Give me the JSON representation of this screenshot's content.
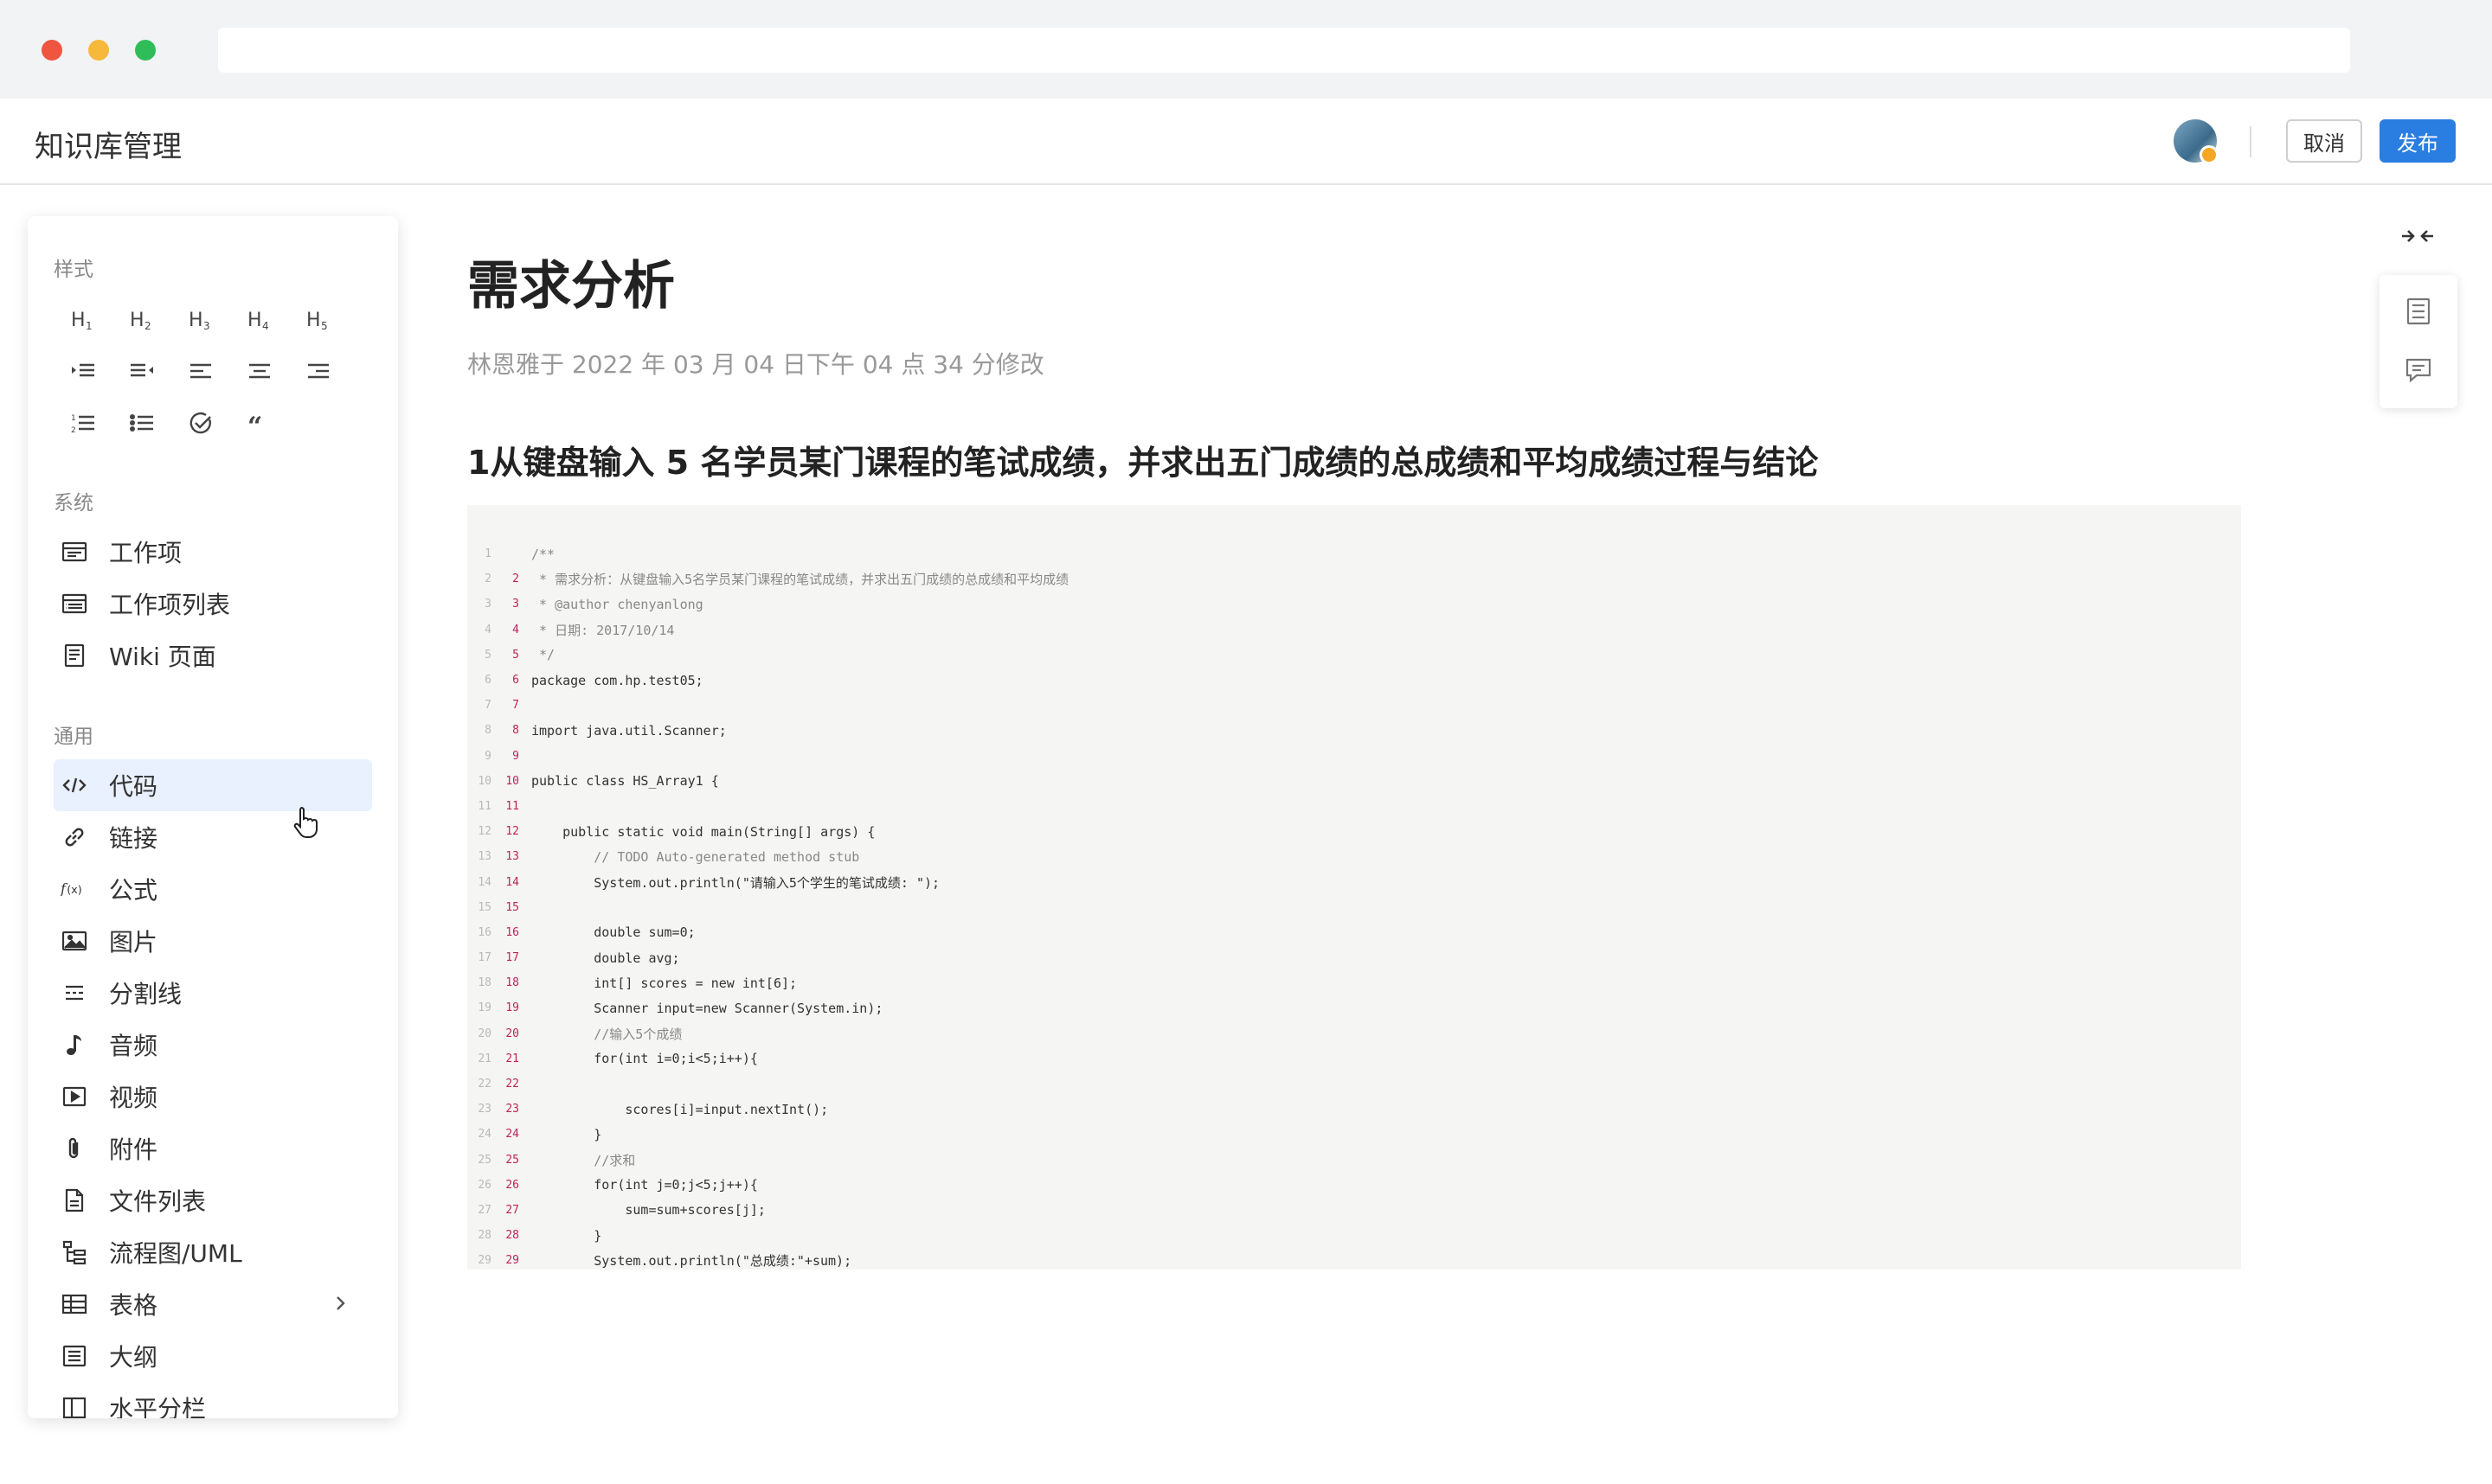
{
  "app": {
    "title": "知识库管理",
    "cancel_label": "取消",
    "publish_label": "发布"
  },
  "panel": {
    "style_label": "样式",
    "headings": [
      "H1",
      "H2",
      "H3",
      "H4",
      "H5"
    ],
    "system_label": "系统",
    "system_items": [
      "工作项",
      "工作项列表",
      "Wiki 页面"
    ],
    "general_label": "通用",
    "general_items": [
      "代码",
      "链接",
      "公式",
      "图片",
      "分割线",
      "音频",
      "视频",
      "附件",
      "文件列表",
      "流程图/UML",
      "表格",
      "大纲",
      "水平分栏"
    ]
  },
  "doc": {
    "title": "需求分析",
    "meta": "林恩雅于 2022 年 03 月 04 日下午 04 点 34 分修改",
    "heading": "1从键盘输入 5 名学员某门课程的笔试成绩，并求出五门成绩的总成绩和平均成绩过程与结论"
  },
  "code": {
    "lines": [
      {
        "n": "1",
        "m": "",
        "t": "/**"
      },
      {
        "n": "2",
        "m": "2",
        "t": " * 需求分析：从键盘输入5名学员某门课程的笔试成绩，并求出五门成绩的总成绩和平均成绩"
      },
      {
        "n": "3",
        "m": "3",
        "t": " * @author chenyanlong"
      },
      {
        "n": "4",
        "m": "4",
        "t": " * 日期: 2017/10/14"
      },
      {
        "n": "5",
        "m": "5",
        "t": " */"
      },
      {
        "n": "6",
        "m": "6",
        "t": "package com.hp.test05;"
      },
      {
        "n": "7",
        "m": "7",
        "t": ""
      },
      {
        "n": "8",
        "m": "8",
        "t": "import java.util.Scanner;"
      },
      {
        "n": "9",
        "m": "9",
        "t": ""
      },
      {
        "n": "10",
        "m": "10",
        "t": "public class HS_Array1 {"
      },
      {
        "n": "11",
        "m": "11",
        "t": ""
      },
      {
        "n": "12",
        "m": "12",
        "t": "    public static void main(String[] args) {"
      },
      {
        "n": "13",
        "m": "13",
        "t": "        // TODO Auto-generated method stub"
      },
      {
        "n": "14",
        "m": "14",
        "t": "        System.out.println(\"请输入5个学生的笔试成绩: \");"
      },
      {
        "n": "15",
        "m": "15",
        "t": ""
      },
      {
        "n": "16",
        "m": "16",
        "t": "        double sum=0;"
      },
      {
        "n": "17",
        "m": "17",
        "t": "        double avg;"
      },
      {
        "n": "18",
        "m": "18",
        "t": "        int[] scores = new int[6];"
      },
      {
        "n": "19",
        "m": "19",
        "t": "        Scanner input=new Scanner(System.in);"
      },
      {
        "n": "20",
        "m": "20",
        "t": "        //输入5个成绩"
      },
      {
        "n": "21",
        "m": "21",
        "t": "        for(int i=0;i<5;i++){"
      },
      {
        "n": "22",
        "m": "22",
        "t": ""
      },
      {
        "n": "23",
        "m": "23",
        "t": "            scores[i]=input.nextInt();"
      },
      {
        "n": "24",
        "m": "24",
        "t": "        }"
      },
      {
        "n": "25",
        "m": "25",
        "t": "        //求和"
      },
      {
        "n": "26",
        "m": "26",
        "t": "        for(int j=0;j<5;j++){"
      },
      {
        "n": "27",
        "m": "27",
        "t": "            sum=sum+scores[j];"
      },
      {
        "n": "28",
        "m": "28",
        "t": "        }"
      },
      {
        "n": "29",
        "m": "29",
        "t": "        System.out.println(\"总成绩:\"+sum);"
      }
    ]
  },
  "colors": {
    "accent": "#2a7de1",
    "active_bg": "#e8f1fd"
  }
}
